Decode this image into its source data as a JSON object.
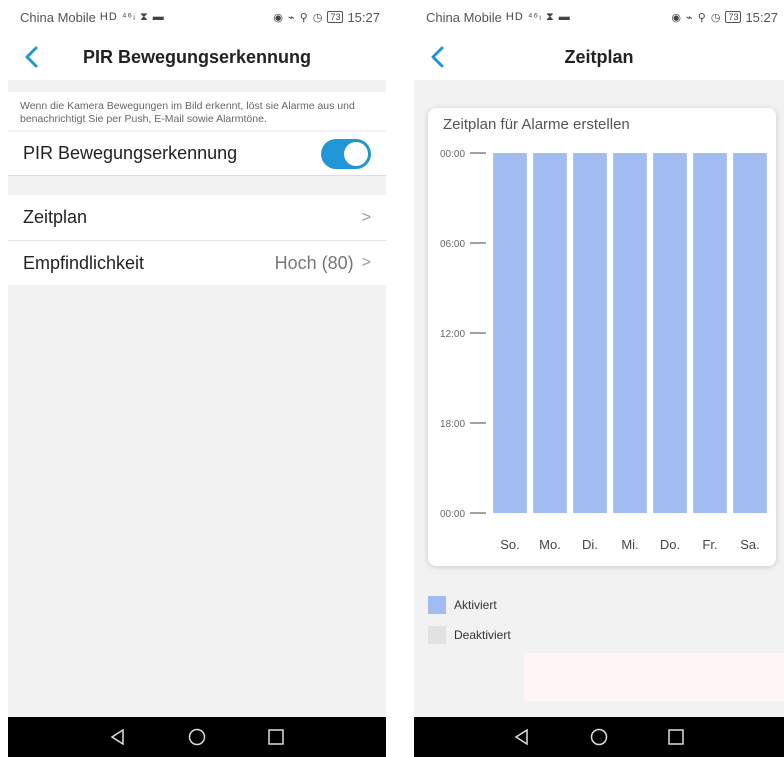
{
  "status_bar": {
    "carrier": "China Mobile",
    "left_indicators": "HD ⁴⁶ₗ ⧗ ▬",
    "right_indicators": "◉ ⌁ ⚲ ◷",
    "battery": "73",
    "time": "15:27"
  },
  "left_screen": {
    "title": "PIR Bewegungserkennung",
    "description": "Wenn die Kamera Bewegungen im Bild erkennt, löst sie Alarme aus und benachrichtigt Sie per Push, E-Mail sowie Alarmtöne.",
    "toggle_label": "PIR Bewegungserkennung",
    "toggle_on": true,
    "rows": [
      {
        "label": "Zeitplan",
        "value": ""
      },
      {
        "label": "Empfindlichkeit",
        "value": "Hoch (80)"
      }
    ]
  },
  "right_screen": {
    "title": "Zeitplan",
    "card_title": "Zeitplan für Alarme erstellen",
    "legend": [
      {
        "label": "Aktiviert",
        "color": "#a0bcf0"
      },
      {
        "label": "Deaktiviert",
        "color": "#e2e2e2"
      }
    ]
  },
  "chart_data": {
    "type": "bar",
    "orientation": "vertical-time-blocks",
    "categories": [
      "So.",
      "Mo.",
      "Di.",
      "Mi.",
      "Do.",
      "Fr.",
      "Sa."
    ],
    "y_ticks": [
      "00:00",
      "06:00",
      "12:00",
      "18:00",
      "00:00"
    ],
    "series": [
      {
        "name": "Aktiviert",
        "start_hours": [
          0,
          0,
          0,
          0,
          0,
          0,
          0
        ],
        "end_hours": [
          24,
          24,
          24,
          24,
          24,
          24,
          24
        ],
        "color": "#a0bcf0"
      }
    ],
    "ylim": [
      0,
      24
    ]
  },
  "android_nav": [
    "back-icon",
    "home-icon",
    "recents-icon"
  ]
}
